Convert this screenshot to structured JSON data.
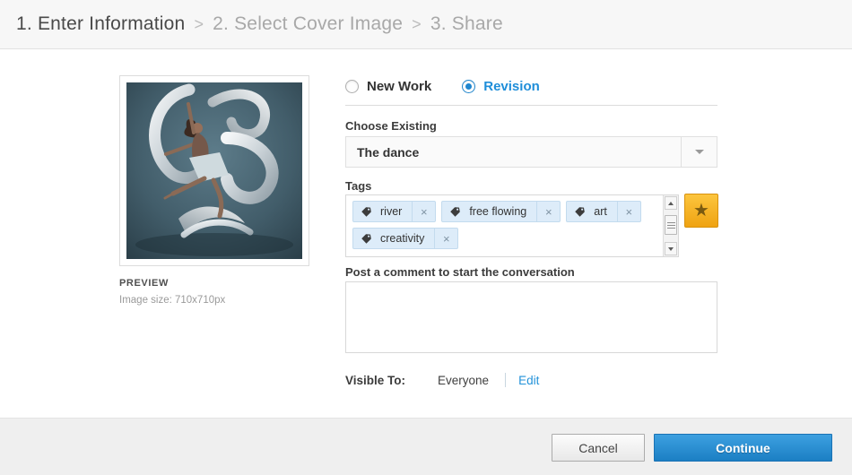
{
  "breadcrumb": {
    "separator": ">",
    "items": [
      {
        "label": "1. Enter Information"
      },
      {
        "label": "2. Select Cover Image"
      },
      {
        "label": "3. Share"
      }
    ]
  },
  "preview": {
    "label": "PREVIEW",
    "image_size": "Image size: 710x710px",
    "image_description": "dancer leaping with swirling silver ribbons on teal studio background"
  },
  "work_type": {
    "options": [
      {
        "label": "New Work",
        "selected": false
      },
      {
        "label": "Revision",
        "selected": true
      }
    ]
  },
  "choose_existing": {
    "label": "Choose Existing",
    "value": "The dance"
  },
  "tags": {
    "label": "Tags",
    "items": [
      "river",
      "free flowing",
      "art",
      "creativity"
    ],
    "remove_symbol": "×"
  },
  "comment": {
    "label": "Post a comment to start the conversation",
    "value": ""
  },
  "visibility": {
    "label": "Visible To:",
    "value": "Everyone",
    "edit_label": "Edit"
  },
  "footer": {
    "cancel_label": "Cancel",
    "continue_label": "Continue"
  },
  "icons": {
    "star": "★"
  },
  "colors": {
    "accent_blue": "#1f8ed9",
    "link_blue": "#2392d9",
    "star_gold": "#efa312",
    "tag_bg": "#ddecf9",
    "continue_blue": "#1b7fc4",
    "header_bg": "#f7f7f7",
    "footer_bg": "#efefef"
  }
}
